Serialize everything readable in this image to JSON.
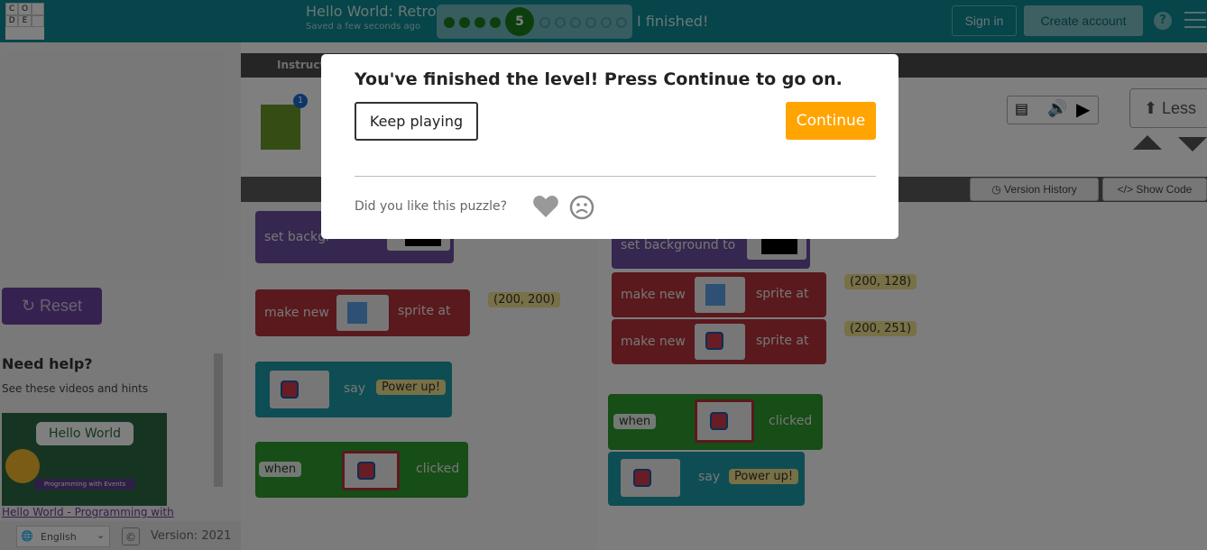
{
  "header": {
    "logo_letters": [
      "C",
      "O",
      "",
      "D",
      "E",
      ""
    ],
    "project_title": "Hello World: Retro",
    "save_status": "Saved a few seconds ago",
    "progress": {
      "completed": 4,
      "current": "5",
      "remaining": 6
    },
    "finished_label": "I finished!",
    "sign_in": "Sign in",
    "create_account": "Create account",
    "help": "?"
  },
  "left": {
    "reset": "Reset",
    "need_help_title": "Need help?",
    "need_help_subtitle": "See these videos and hints",
    "video_thumb_title": "Hello World",
    "video_thumb_subtitle": "Programming with Events",
    "video_link": "Hello World - Programming with",
    "language": "English",
    "version": "Version: 2021"
  },
  "instructions": {
    "tab_label": "Instruct",
    "less_label": "Less",
    "sprite_badge": "1"
  },
  "workspace_header": {
    "version_history": "Version History",
    "show_code": "Show Code"
  },
  "toolbox": {
    "set_background": "set backgr",
    "make_new": "make new",
    "sprite_at": "sprite at",
    "coords": "(200, 200)",
    "say": "say",
    "say_text": "Power up!",
    "when": "when",
    "clicked": "clicked"
  },
  "workspace": {
    "set_background": "set background to",
    "make_new_1": "make new",
    "sprite_at_1": "sprite at",
    "coords_1": "(200, 128)",
    "make_new_2": "make new",
    "sprite_at_2": "sprite at",
    "coords_2": "(200, 251)",
    "when": "when",
    "clicked": "clicked",
    "say": "say",
    "say_text": "Power up!"
  },
  "dialog": {
    "message": "You've finished the level! Press Continue to go on.",
    "keep_playing": "Keep playing",
    "continue": "Continue",
    "feedback_question": "Did you like this puzzle?"
  },
  "colors": {
    "header": "#0c8b92",
    "continue": "#ffa400",
    "reset": "#6c45a0",
    "level_done": "#1b7c1b"
  }
}
